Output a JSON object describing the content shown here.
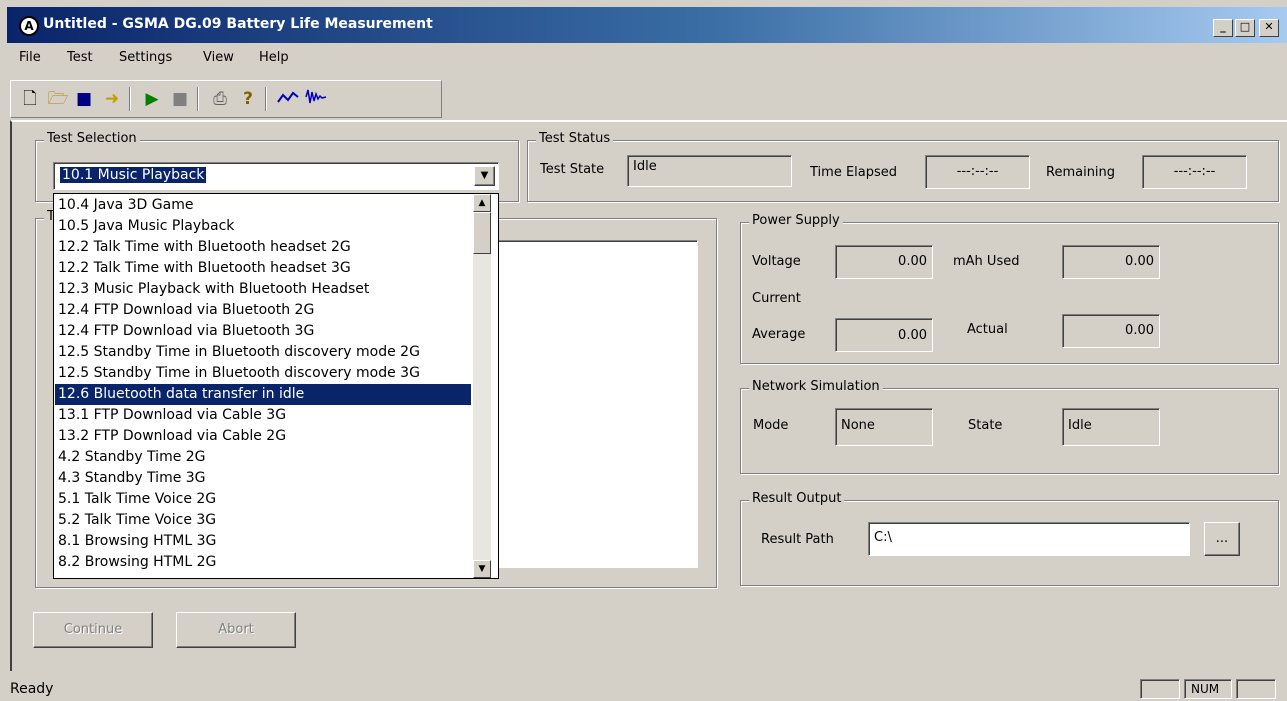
{
  "window": {
    "title": "Untitled - GSMA DG.09 Battery Life Measurement",
    "controls": {
      "minimize": "_",
      "maximize": "□",
      "close": "✕"
    }
  },
  "menu": [
    "File",
    "Test",
    "Settings",
    "View",
    "Help"
  ],
  "toolbar": {
    "icons": [
      "new-file-icon",
      "open-folder-icon",
      "save-icon",
      "export-icon",
      "play-icon",
      "stop-icon",
      "print-icon",
      "help-icon",
      "graph-icon",
      "waveform-icon"
    ]
  },
  "test_selection": {
    "legend": "Test Selection",
    "selected": "10.1 Music Playback",
    "options": [
      "10.4 Java 3D Game",
      "10.5 Java Music Playback",
      "12.2 Talk Time with Bluetooth headset 2G",
      "12.2 Talk Time with Bluetooth headset 3G",
      "12.3 Music Playback with Bluetooth Headset",
      "12.4 FTP Download via Bluetooth 2G",
      "12.4 FTP Download via Bluetooth 3G",
      "12.5 Standby Time in Bluetooth discovery mode 2G",
      "12.5 Standby Time in Bluetooth discovery mode 3G",
      "12.6 Bluetooth data transfer in idle",
      "13.1 FTP Download via Cable 3G",
      "13.2 FTP Download via Cable 2G",
      "4.2 Standby Time 2G",
      "4.3 Standby Time 3G",
      "5.1 Talk Time Voice 2G",
      "5.2 Talk Time Voice 3G",
      "8.1 Browsing HTML 3G",
      "8.2 Browsing HTML 2G"
    ],
    "highlighted_index": 9
  },
  "hidden_group_fragment": "T",
  "test_status": {
    "legend": "Test Status",
    "state_label": "Test State",
    "state_value": "Idle",
    "elapsed_label": "Time Elapsed",
    "elapsed_value": "---:--:--",
    "remaining_label": "Remaining",
    "remaining_value": "---:--:--"
  },
  "power_supply": {
    "legend": "Power Supply",
    "voltage_label": "Voltage",
    "voltage_value": "0.00",
    "mah_label": "mAh Used",
    "mah_value": "0.00",
    "current_label": "Current",
    "average_label": "Average",
    "average_value": "0.00",
    "actual_label": "Actual",
    "actual_value": "0.00"
  },
  "network_simulation": {
    "legend": "Network Simulation",
    "mode_label": "Mode",
    "mode_value": "None",
    "state_label": "State",
    "state_value": "Idle"
  },
  "result_output": {
    "legend": "Result Output",
    "path_label": "Result Path",
    "path_value": "C:\\",
    "browse_label": "..."
  },
  "buttons": {
    "continue": "Continue",
    "abort": "Abort"
  },
  "statusbar": {
    "text": "Ready",
    "num": "NUM"
  }
}
